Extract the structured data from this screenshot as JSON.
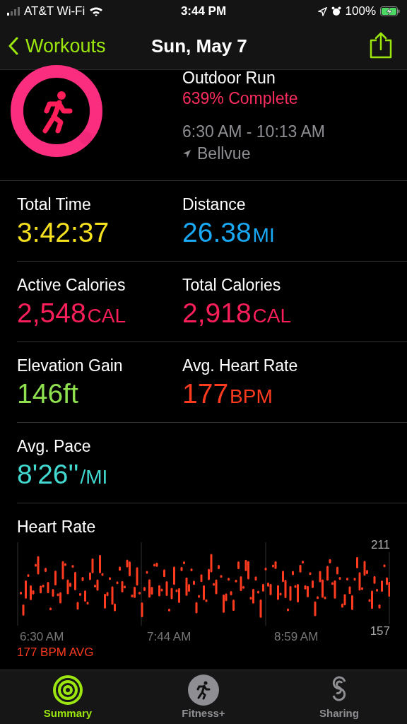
{
  "status_bar": {
    "carrier": "AT&T Wi-Fi",
    "time": "3:44 PM",
    "battery": "100%"
  },
  "nav": {
    "back": "Workouts",
    "title": "Sun, May 7"
  },
  "workout": {
    "name": "Outdoor Run",
    "progress": "639% Complete",
    "time_range": "6:30 AM - 10:13 AM",
    "location": "Bellvue"
  },
  "metrics": [
    [
      {
        "label": "Total Time",
        "value": "3:42:37",
        "color": "#f5e11f"
      },
      {
        "label": "Distance",
        "value": "26.38",
        "unit": "MI",
        "color": "#19a9f5"
      }
    ],
    [
      {
        "label": "Active Calories",
        "value": "2,548",
        "unit": "CAL",
        "color": "#fa1f5a"
      },
      {
        "label": "Total Calories",
        "value": "2,918",
        "unit": "CAL",
        "color": "#fa1f5a"
      }
    ],
    [
      {
        "label": "Elevation Gain",
        "value": "146ft",
        "color": "#8ee04f"
      },
      {
        "label": "Avg. Heart Rate",
        "value": "177",
        "unit": "BPM",
        "color": "#ff3b1f"
      }
    ],
    [
      {
        "label": "Avg. Pace",
        "value": "8'26''",
        "unit": "/MI",
        "color": "#41d9d0"
      }
    ]
  ],
  "heart_rate": {
    "title": "Heart Rate",
    "max": "211",
    "min": "157",
    "times": [
      "6:30 AM",
      "7:44 AM",
      "8:59 AM"
    ],
    "average": "177 BPM AVG"
  },
  "tabs": [
    {
      "label": "Summary",
      "selected": true
    },
    {
      "label": "Fitness+",
      "selected": false
    },
    {
      "label": "Sharing",
      "selected": false
    }
  ]
}
